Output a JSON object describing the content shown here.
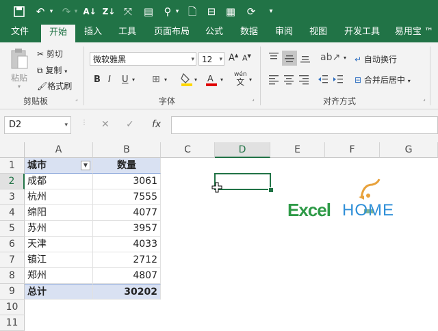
{
  "qat": {
    "icons": [
      "save-icon",
      "undo-icon",
      "redo-icon",
      "sort-asc-icon",
      "sort-desc-icon",
      "fit-icon",
      "form-icon",
      "find-icon",
      "new-file-icon",
      "open-file-icon",
      "folder-icon",
      "refresh-icon",
      "customize-icon"
    ]
  },
  "tabs": [
    {
      "label": "文件"
    },
    {
      "label": "开始"
    },
    {
      "label": "插入"
    },
    {
      "label": "工具"
    },
    {
      "label": "页面布局"
    },
    {
      "label": "公式"
    },
    {
      "label": "数据"
    },
    {
      "label": "审阅"
    },
    {
      "label": "视图"
    },
    {
      "label": "开发工具"
    },
    {
      "label": "易用宝 ™"
    }
  ],
  "ribbon": {
    "paste": "粘贴",
    "cut": "剪切",
    "copy": "复制",
    "format_painter": "格式刷",
    "clipboard_group": "剪贴板",
    "font_name": "微软雅黑",
    "font_size": "12",
    "bold": "B",
    "italic": "I",
    "underline": "U",
    "wen_label": "wén",
    "wen_char": "文",
    "font_group": "字体",
    "wrap_text": "自动换行",
    "merge_center": "合并后居中",
    "align_group": "对齐方式"
  },
  "formula_bar": {
    "name_box": "D2",
    "fx": "fx",
    "cancel": "✕",
    "enter": "✓",
    "value": ""
  },
  "columns": [
    "A",
    "B",
    "C",
    "D",
    "E",
    "F",
    "G"
  ],
  "rows": [
    "1",
    "2",
    "3",
    "4",
    "5",
    "6",
    "7",
    "8",
    "9",
    "10",
    "11"
  ],
  "table": {
    "header": {
      "city": "城市",
      "qty": "数量"
    },
    "data": [
      {
        "city": "成都",
        "qty": "3061"
      },
      {
        "city": "杭州",
        "qty": "7555"
      },
      {
        "city": "绵阳",
        "qty": "4077"
      },
      {
        "city": "苏州",
        "qty": "3957"
      },
      {
        "city": "天津",
        "qty": "4033"
      },
      {
        "city": "镇江",
        "qty": "2712"
      },
      {
        "city": "郑州",
        "qty": "4807"
      }
    ],
    "total": {
      "label": "总计",
      "value": "30202"
    }
  },
  "logo": {
    "text_excel": "Excel",
    "text_home": "HOME"
  },
  "colors": {
    "accent": "#217346",
    "table_header": "#d9e1f2",
    "logo_green": "#2e9a47",
    "logo_blue": "#2f8fd8",
    "logo_orange": "#e8a23c"
  }
}
